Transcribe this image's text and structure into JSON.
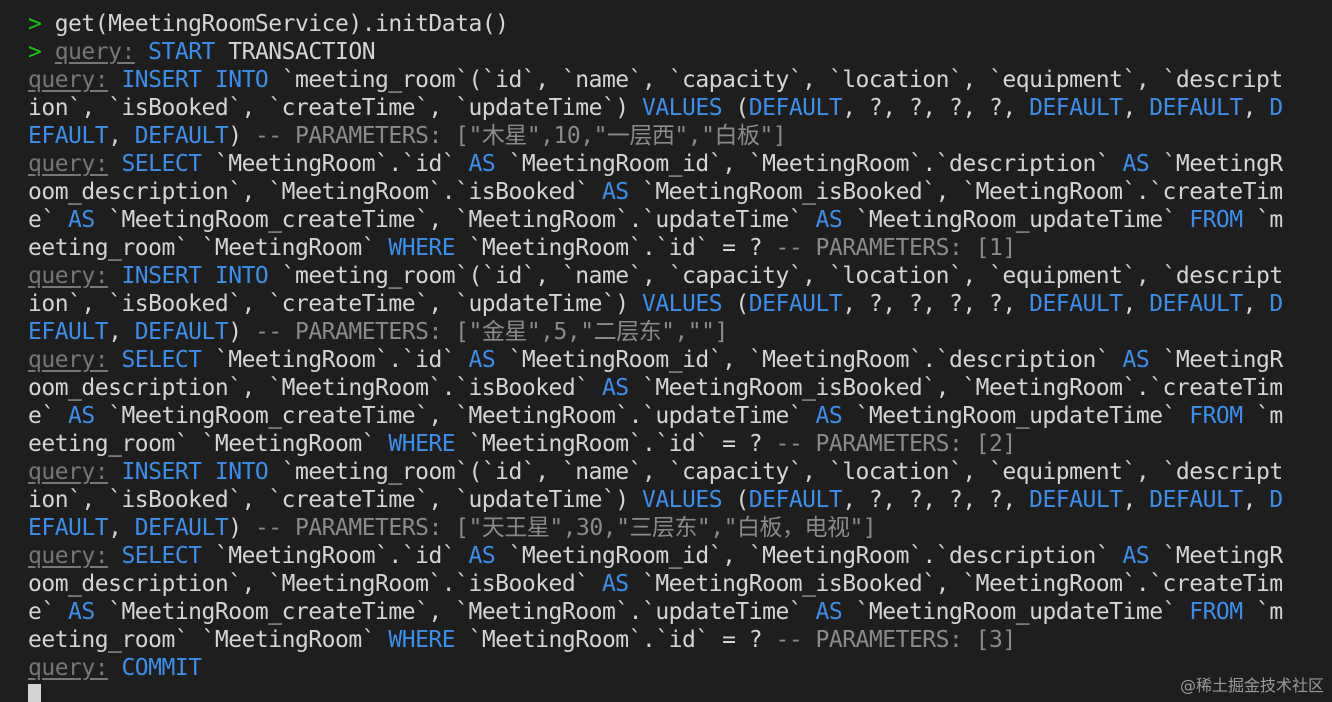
{
  "colors": {
    "background": "#1e1e1e",
    "text": "#d4d4d4",
    "prompt": "#16c60c",
    "query_label": "#767676",
    "keyword": "#3b8eea",
    "comment": "#8a8a8a"
  },
  "terminal": {
    "lines": [
      {
        "name": "command-line",
        "segments": [
          [
            "prompt",
            "> "
          ],
          [
            "tx",
            "get(MeetingRoomService).initData()"
          ]
        ]
      },
      {
        "name": "start-transaction-line",
        "segments": [
          [
            "prompt",
            "> "
          ],
          [
            "query",
            "query:"
          ],
          [
            "tx",
            " "
          ],
          [
            "kw",
            "START"
          ],
          [
            "tx",
            " TRANSACTION"
          ]
        ]
      },
      {
        "name": "insert-1-line-1",
        "segments": [
          [
            "query",
            "query:"
          ],
          [
            "tx",
            " "
          ],
          [
            "kw",
            "INSERT INTO"
          ],
          [
            "tx",
            " `meeting_room`(`id`, `name`, `capacity`, `location`, `equipment`, `descript"
          ]
        ]
      },
      {
        "name": "insert-1-line-2",
        "segments": [
          [
            "tx",
            "ion`, `isBooked`, `createTime`, `updateTime`) "
          ],
          [
            "kw",
            "VALUES"
          ],
          [
            "tx",
            " ("
          ],
          [
            "kw",
            "DEFAULT"
          ],
          [
            "tx",
            ", ?, ?, ?, ?, "
          ],
          [
            "kw",
            "DEFAULT"
          ],
          [
            "tx",
            ", "
          ],
          [
            "kw",
            "DEFAULT"
          ],
          [
            "tx",
            ", "
          ],
          [
            "kw",
            "D"
          ]
        ]
      },
      {
        "name": "insert-1-line-3",
        "segments": [
          [
            "kw",
            "EFAULT"
          ],
          [
            "tx",
            ", "
          ],
          [
            "kw",
            "DEFAULT"
          ],
          [
            "tx",
            ") "
          ],
          [
            "cm",
            "-- PARAMETERS: [\"木星\",10,\"一层西\",\"白板\"]"
          ]
        ]
      },
      {
        "name": "select-1-line-1",
        "segments": [
          [
            "query",
            "query:"
          ],
          [
            "tx",
            " "
          ],
          [
            "kw",
            "SELECT"
          ],
          [
            "tx",
            " `MeetingRoom`.`id` "
          ],
          [
            "kw",
            "AS"
          ],
          [
            "tx",
            " `MeetingRoom_id`, `MeetingRoom`.`description` "
          ],
          [
            "kw",
            "AS"
          ],
          [
            "tx",
            " `MeetingR"
          ]
        ]
      },
      {
        "name": "select-1-line-2",
        "segments": [
          [
            "tx",
            "oom_description`, `MeetingRoom`.`isBooked` "
          ],
          [
            "kw",
            "AS"
          ],
          [
            "tx",
            " `MeetingRoom_isBooked`, `MeetingRoom`.`createTim"
          ]
        ]
      },
      {
        "name": "select-1-line-3",
        "segments": [
          [
            "tx",
            "e` "
          ],
          [
            "kw",
            "AS"
          ],
          [
            "tx",
            " `MeetingRoom_createTime`, `MeetingRoom`.`updateTime` "
          ],
          [
            "kw",
            "AS"
          ],
          [
            "tx",
            " `MeetingRoom_updateTime` "
          ],
          [
            "kw",
            "FROM"
          ],
          [
            "tx",
            " `m"
          ]
        ]
      },
      {
        "name": "select-1-line-4",
        "segments": [
          [
            "tx",
            "eeting_room` `MeetingRoom` "
          ],
          [
            "kw",
            "WHERE"
          ],
          [
            "tx",
            " `MeetingRoom`.`id` = ? "
          ],
          [
            "cm",
            "-- PARAMETERS: [1]"
          ]
        ]
      },
      {
        "name": "insert-2-line-1",
        "segments": [
          [
            "query",
            "query:"
          ],
          [
            "tx",
            " "
          ],
          [
            "kw",
            "INSERT INTO"
          ],
          [
            "tx",
            " `meeting_room`(`id`, `name`, `capacity`, `location`, `equipment`, `descript"
          ]
        ]
      },
      {
        "name": "insert-2-line-2",
        "segments": [
          [
            "tx",
            "ion`, `isBooked`, `createTime`, `updateTime`) "
          ],
          [
            "kw",
            "VALUES"
          ],
          [
            "tx",
            " ("
          ],
          [
            "kw",
            "DEFAULT"
          ],
          [
            "tx",
            ", ?, ?, ?, ?, "
          ],
          [
            "kw",
            "DEFAULT"
          ],
          [
            "tx",
            ", "
          ],
          [
            "kw",
            "DEFAULT"
          ],
          [
            "tx",
            ", "
          ],
          [
            "kw",
            "D"
          ]
        ]
      },
      {
        "name": "insert-2-line-3",
        "segments": [
          [
            "kw",
            "EFAULT"
          ],
          [
            "tx",
            ", "
          ],
          [
            "kw",
            "DEFAULT"
          ],
          [
            "tx",
            ") "
          ],
          [
            "cm",
            "-- PARAMETERS: [\"金星\",5,\"二层东\",\"\"]"
          ]
        ]
      },
      {
        "name": "select-2-line-1",
        "segments": [
          [
            "query",
            "query:"
          ],
          [
            "tx",
            " "
          ],
          [
            "kw",
            "SELECT"
          ],
          [
            "tx",
            " `MeetingRoom`.`id` "
          ],
          [
            "kw",
            "AS"
          ],
          [
            "tx",
            " `MeetingRoom_id`, `MeetingRoom`.`description` "
          ],
          [
            "kw",
            "AS"
          ],
          [
            "tx",
            " `MeetingR"
          ]
        ]
      },
      {
        "name": "select-2-line-2",
        "segments": [
          [
            "tx",
            "oom_description`, `MeetingRoom`.`isBooked` "
          ],
          [
            "kw",
            "AS"
          ],
          [
            "tx",
            " `MeetingRoom_isBooked`, `MeetingRoom`.`createTim"
          ]
        ]
      },
      {
        "name": "select-2-line-3",
        "segments": [
          [
            "tx",
            "e` "
          ],
          [
            "kw",
            "AS"
          ],
          [
            "tx",
            " `MeetingRoom_createTime`, `MeetingRoom`.`updateTime` "
          ],
          [
            "kw",
            "AS"
          ],
          [
            "tx",
            " `MeetingRoom_updateTime` "
          ],
          [
            "kw",
            "FROM"
          ],
          [
            "tx",
            " `m"
          ]
        ]
      },
      {
        "name": "select-2-line-4",
        "segments": [
          [
            "tx",
            "eeting_room` `MeetingRoom` "
          ],
          [
            "kw",
            "WHERE"
          ],
          [
            "tx",
            " `MeetingRoom`.`id` = ? "
          ],
          [
            "cm",
            "-- PARAMETERS: [2]"
          ]
        ]
      },
      {
        "name": "insert-3-line-1",
        "segments": [
          [
            "query",
            "query:"
          ],
          [
            "tx",
            " "
          ],
          [
            "kw",
            "INSERT INTO"
          ],
          [
            "tx",
            " `meeting_room`(`id`, `name`, `capacity`, `location`, `equipment`, `descript"
          ]
        ]
      },
      {
        "name": "insert-3-line-2",
        "segments": [
          [
            "tx",
            "ion`, `isBooked`, `createTime`, `updateTime`) "
          ],
          [
            "kw",
            "VALUES"
          ],
          [
            "tx",
            " ("
          ],
          [
            "kw",
            "DEFAULT"
          ],
          [
            "tx",
            ", ?, ?, ?, ?, "
          ],
          [
            "kw",
            "DEFAULT"
          ],
          [
            "tx",
            ", "
          ],
          [
            "kw",
            "DEFAULT"
          ],
          [
            "tx",
            ", "
          ],
          [
            "kw",
            "D"
          ]
        ]
      },
      {
        "name": "insert-3-line-3",
        "segments": [
          [
            "kw",
            "EFAULT"
          ],
          [
            "tx",
            ", "
          ],
          [
            "kw",
            "DEFAULT"
          ],
          [
            "tx",
            ") "
          ],
          [
            "cm",
            "-- PARAMETERS: [\"天王星\",30,\"三层东\",\"白板，电视\"]"
          ]
        ]
      },
      {
        "name": "select-3-line-1",
        "segments": [
          [
            "query",
            "query:"
          ],
          [
            "tx",
            " "
          ],
          [
            "kw",
            "SELECT"
          ],
          [
            "tx",
            " `MeetingRoom`.`id` "
          ],
          [
            "kw",
            "AS"
          ],
          [
            "tx",
            " `MeetingRoom_id`, `MeetingRoom`.`description` "
          ],
          [
            "kw",
            "AS"
          ],
          [
            "tx",
            " `MeetingR"
          ]
        ]
      },
      {
        "name": "select-3-line-2",
        "segments": [
          [
            "tx",
            "oom_description`, `MeetingRoom`.`isBooked` "
          ],
          [
            "kw",
            "AS"
          ],
          [
            "tx",
            " `MeetingRoom_isBooked`, `MeetingRoom`.`createTim"
          ]
        ]
      },
      {
        "name": "select-3-line-3",
        "segments": [
          [
            "tx",
            "e` "
          ],
          [
            "kw",
            "AS"
          ],
          [
            "tx",
            " `MeetingRoom_createTime`, `MeetingRoom`.`updateTime` "
          ],
          [
            "kw",
            "AS"
          ],
          [
            "tx",
            " `MeetingRoom_updateTime` "
          ],
          [
            "kw",
            "FROM"
          ],
          [
            "tx",
            " `m"
          ]
        ]
      },
      {
        "name": "select-3-line-4",
        "segments": [
          [
            "tx",
            "eeting_room` `MeetingRoom` "
          ],
          [
            "kw",
            "WHERE"
          ],
          [
            "tx",
            " `MeetingRoom`.`id` = ? "
          ],
          [
            "cm",
            "-- PARAMETERS: [3]"
          ]
        ]
      },
      {
        "name": "commit-line",
        "segments": [
          [
            "query",
            "query:"
          ],
          [
            "tx",
            " "
          ],
          [
            "kw",
            "COMMIT"
          ]
        ]
      }
    ]
  },
  "watermark": "@稀土掘金技术社区"
}
